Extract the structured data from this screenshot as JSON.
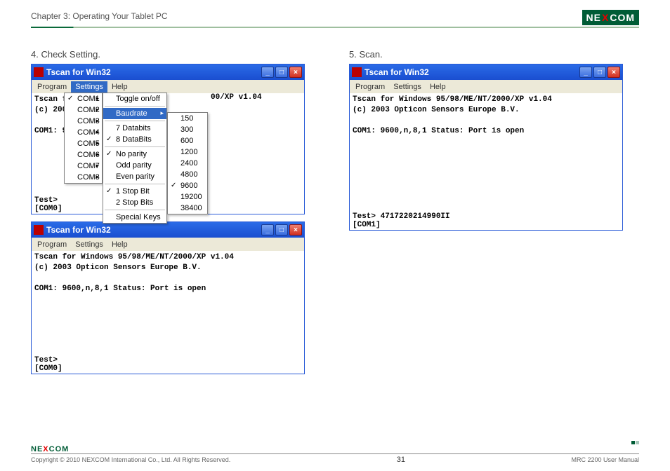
{
  "header": {
    "chapter": "Chapter 3: Operating Your Tablet PC",
    "logo_text_left": "NE",
    "logo_x": "X",
    "logo_text_right": "COM"
  },
  "steps": {
    "s4": "4. Check Setting.",
    "s5": "5. Scan."
  },
  "win_common": {
    "title": "Tscan for Win32",
    "menu_program": "Program",
    "menu_settings": "Settings",
    "menu_help": "Help",
    "line1": "Tscan for Windows 95/98/ME/NT/2000/XP v1.04",
    "line1_trunc": "00/XP v1.04",
    "line2": "(c) 2003 Opticon Sensors Europe B.V.",
    "line2_trunc": "(c) 2003",
    "com_line": "COM1: 9600,n,8,1    Status: Port is open",
    "com_trunc": "COM1: 9",
    "test_prompt": "Test>",
    "com0": "[COM0]",
    "com1": "[COM1]",
    "scan_result": "Test>   4717220214990II"
  },
  "dd_com": {
    "items": [
      "COM1",
      "COM2",
      "COM3",
      "COM4",
      "COM5",
      "COM6",
      "COM7",
      "COM8"
    ],
    "checked": "COM1"
  },
  "dd_col2": {
    "toggle": "Toggle on/off",
    "baudrate": "Baudrate",
    "databits7": "7 Databits",
    "databits8": "8 DataBits",
    "noparity": "No parity",
    "oddparity": "Odd parity",
    "evenparity": "Even parity",
    "stop1": "1 Stop Bit",
    "stop2": "2 Stop Bits",
    "special": "Special Keys"
  },
  "dd_baud": {
    "items": [
      "150",
      "300",
      "600",
      "1200",
      "2400",
      "4800",
      "9600",
      "19200",
      "38400"
    ],
    "checked": "9600"
  },
  "footer": {
    "copyright": "Copyright © 2010 NEXCOM International Co., Ltd. All Rights Reserved.",
    "page": "31",
    "manual": "MRC 2200 User Manual"
  }
}
